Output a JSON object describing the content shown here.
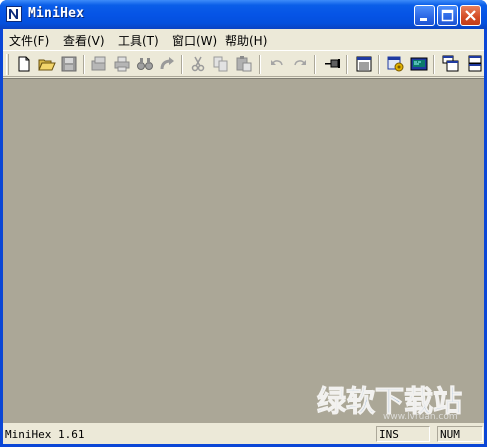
{
  "window": {
    "title": "MiniHex"
  },
  "menu": [
    "文件(F)",
    "查看(V)",
    "工具(T)",
    "窗口(W)",
    "帮助(H)"
  ],
  "toolbar": {
    "buttons": [
      "new-file",
      "open-folder",
      "save",
      "properties",
      "print",
      "find",
      "redo-search",
      "cut",
      "copy",
      "paste",
      "undo",
      "redo",
      "pin",
      "document-view",
      "settings",
      "display",
      "cascade-windows",
      "tile-windows"
    ]
  },
  "status": {
    "main": "MiniHex 1.61",
    "ins": "INS",
    "num": "NUM"
  },
  "watermark": "绿软下载站"
}
